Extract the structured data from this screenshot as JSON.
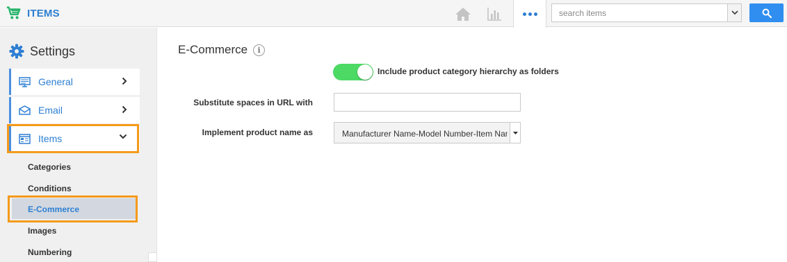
{
  "app": {
    "title": "ITEMS",
    "brand_color": "#2d7fd3",
    "icon": "shopping-cart-icon"
  },
  "topbar": {
    "icons": [
      "home-icon",
      "bar-chart-icon",
      "more-dots-icon"
    ],
    "search": {
      "placeholder": "search items",
      "button_icon": "search-icon"
    }
  },
  "sidebar": {
    "heading": "Settings",
    "heading_icon": "gear-icon",
    "items": [
      {
        "label": "General",
        "icon": "monitor-icon",
        "chevron": "chevron-right-icon"
      },
      {
        "label": "Email",
        "icon": "envelope-icon",
        "chevron": "chevron-right-icon"
      },
      {
        "label": "Items",
        "icon": "list-window-icon",
        "chevron": "chevron-down-icon",
        "expanded": true
      }
    ],
    "subitems": [
      {
        "label": "Categories"
      },
      {
        "label": "Conditions"
      },
      {
        "label": "E-Commerce",
        "active": true
      },
      {
        "label": "Images"
      },
      {
        "label": "Numbering"
      }
    ],
    "highlight_color": "#f59a1a"
  },
  "main": {
    "title": "E-Commerce",
    "info_icon": "info-icon",
    "toggle": {
      "label": "Include product category hierarchy as folders",
      "on": true,
      "color": "#4cd964"
    },
    "fields": [
      {
        "label": "Substitute spaces in URL with",
        "value": ""
      },
      {
        "label": "Implement product name as",
        "value": "Manufacturer Name-Model Number-Item Name"
      }
    ]
  }
}
